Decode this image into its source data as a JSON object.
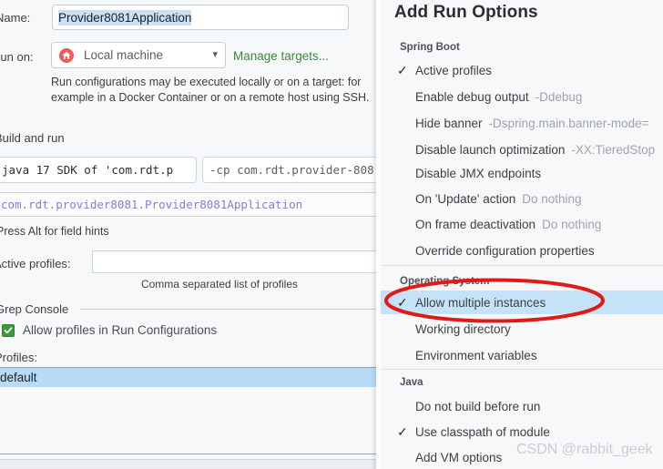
{
  "dialog": {
    "name_label": "Name:",
    "name_value": "Provider8081Application",
    "run_on_label": "Run on:",
    "run_on_value": "Local machine",
    "run_on_icon": "home-icon",
    "manage_targets_link": "Manage targets...",
    "targets_hint": "Run configurations may be executed locally or on a target: for example in a Docker Container or on a remote host using SSH.",
    "build_and_run_title": "Build and run",
    "sdk_field_value": "java 17 SDK of 'com.rdt.p",
    "cp_field_value": "-cp com.rdt.provider-808",
    "main_class_value": "com.rdt.provider8081.Provider8081Application",
    "press_alt_hint": "Press Alt for field hints",
    "active_profiles_label": "Active profiles:",
    "active_profiles_value": "",
    "active_profiles_placeholder": "",
    "comma_hint": "Comma separated list of profiles",
    "grep_console_title": "Grep Console",
    "allow_profiles_checkbox_label": "Allow profiles in Run Configurations",
    "allow_profiles_checked": true,
    "profiles_label": "Profiles:",
    "profiles_items": [
      "default"
    ],
    "profiles_selected": "default"
  },
  "popup": {
    "title": "Add Run Options",
    "sections": [
      {
        "name": "Spring Boot",
        "items": [
          {
            "label": "Active profiles",
            "value": "",
            "checked": true
          },
          {
            "label": "Enable debug output",
            "value": "-Ddebug",
            "checked": false
          },
          {
            "label": "Hide banner",
            "value": "-Dspring.main.banner-mode=",
            "checked": false
          },
          {
            "label": "Disable launch optimization",
            "value": "-XX:TieredStop",
            "checked": false
          },
          {
            "label": "Disable JMX endpoints",
            "value": "",
            "checked": false
          },
          {
            "label": "On 'Update' action",
            "value": "Do nothing",
            "checked": false
          },
          {
            "label": "On frame deactivation",
            "value": "Do nothing",
            "checked": false
          },
          {
            "label": "Override configuration properties",
            "value": "",
            "checked": false
          }
        ]
      },
      {
        "name": "Operating System",
        "items": [
          {
            "label": "Allow multiple instances",
            "value": "",
            "checked": true,
            "highlighted": true
          },
          {
            "label": "Working directory",
            "value": "",
            "checked": false
          },
          {
            "label": "Environment variables",
            "value": "",
            "checked": false
          }
        ]
      },
      {
        "name": "Java",
        "items": [
          {
            "label": "Do not build before run",
            "value": "",
            "checked": false
          },
          {
            "label": "Use classpath of module",
            "value": "",
            "checked": true
          },
          {
            "label": "Add VM options",
            "value": "",
            "checked": false
          }
        ]
      }
    ]
  },
  "annotation": {
    "ellipse_color": "#e01b16",
    "ellipse_target": "Allow multiple instances"
  },
  "watermark": {
    "text": "CSDN @rabbit_geek"
  },
  "colors": {
    "panel_bg": "#f7f8fa",
    "selection_blue": "#c5e3f8",
    "link_green": "#3a8a3a",
    "mono_purple": "#8e7ad1",
    "checkbox_green": "#3a9a3a",
    "annotation_red": "#e01b16"
  }
}
